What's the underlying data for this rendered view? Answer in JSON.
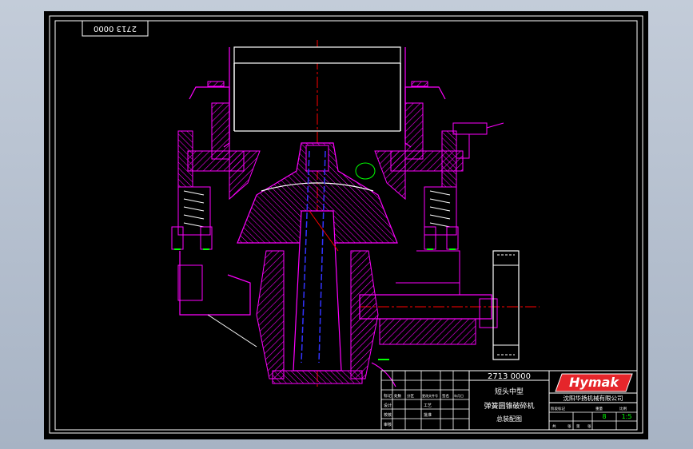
{
  "drawing": {
    "stamp": "2713 0000",
    "title_block": {
      "drawing_number": "2713 0000",
      "product_line_1": "短头中型",
      "product_line_2": "弹簧圆锥破碎机",
      "drawing_name": "总装配图",
      "brand_logo": "Hymak",
      "company": "沈阳华扬机械有限公司",
      "sheet_count": "8",
      "scale": "1:5",
      "left_rows": [
        "标记",
        "设计",
        "校核",
        "审核",
        "工艺",
        "批准"
      ],
      "sign_cols": [
        "处数",
        "分区",
        "更改文件号",
        "签名",
        "年月日"
      ],
      "right_labels": [
        "阶段标记",
        "重量",
        "比例",
        "共",
        "张",
        "第",
        "张"
      ]
    },
    "colors": {
      "background": "#000000",
      "frame": "#ffffff",
      "part": "#ff00ff",
      "centerline": "#ff0000",
      "shaft": "#3333ff",
      "accent": "#00ff00",
      "liner": "#ffffff",
      "logo_red": "#e5262b"
    }
  }
}
